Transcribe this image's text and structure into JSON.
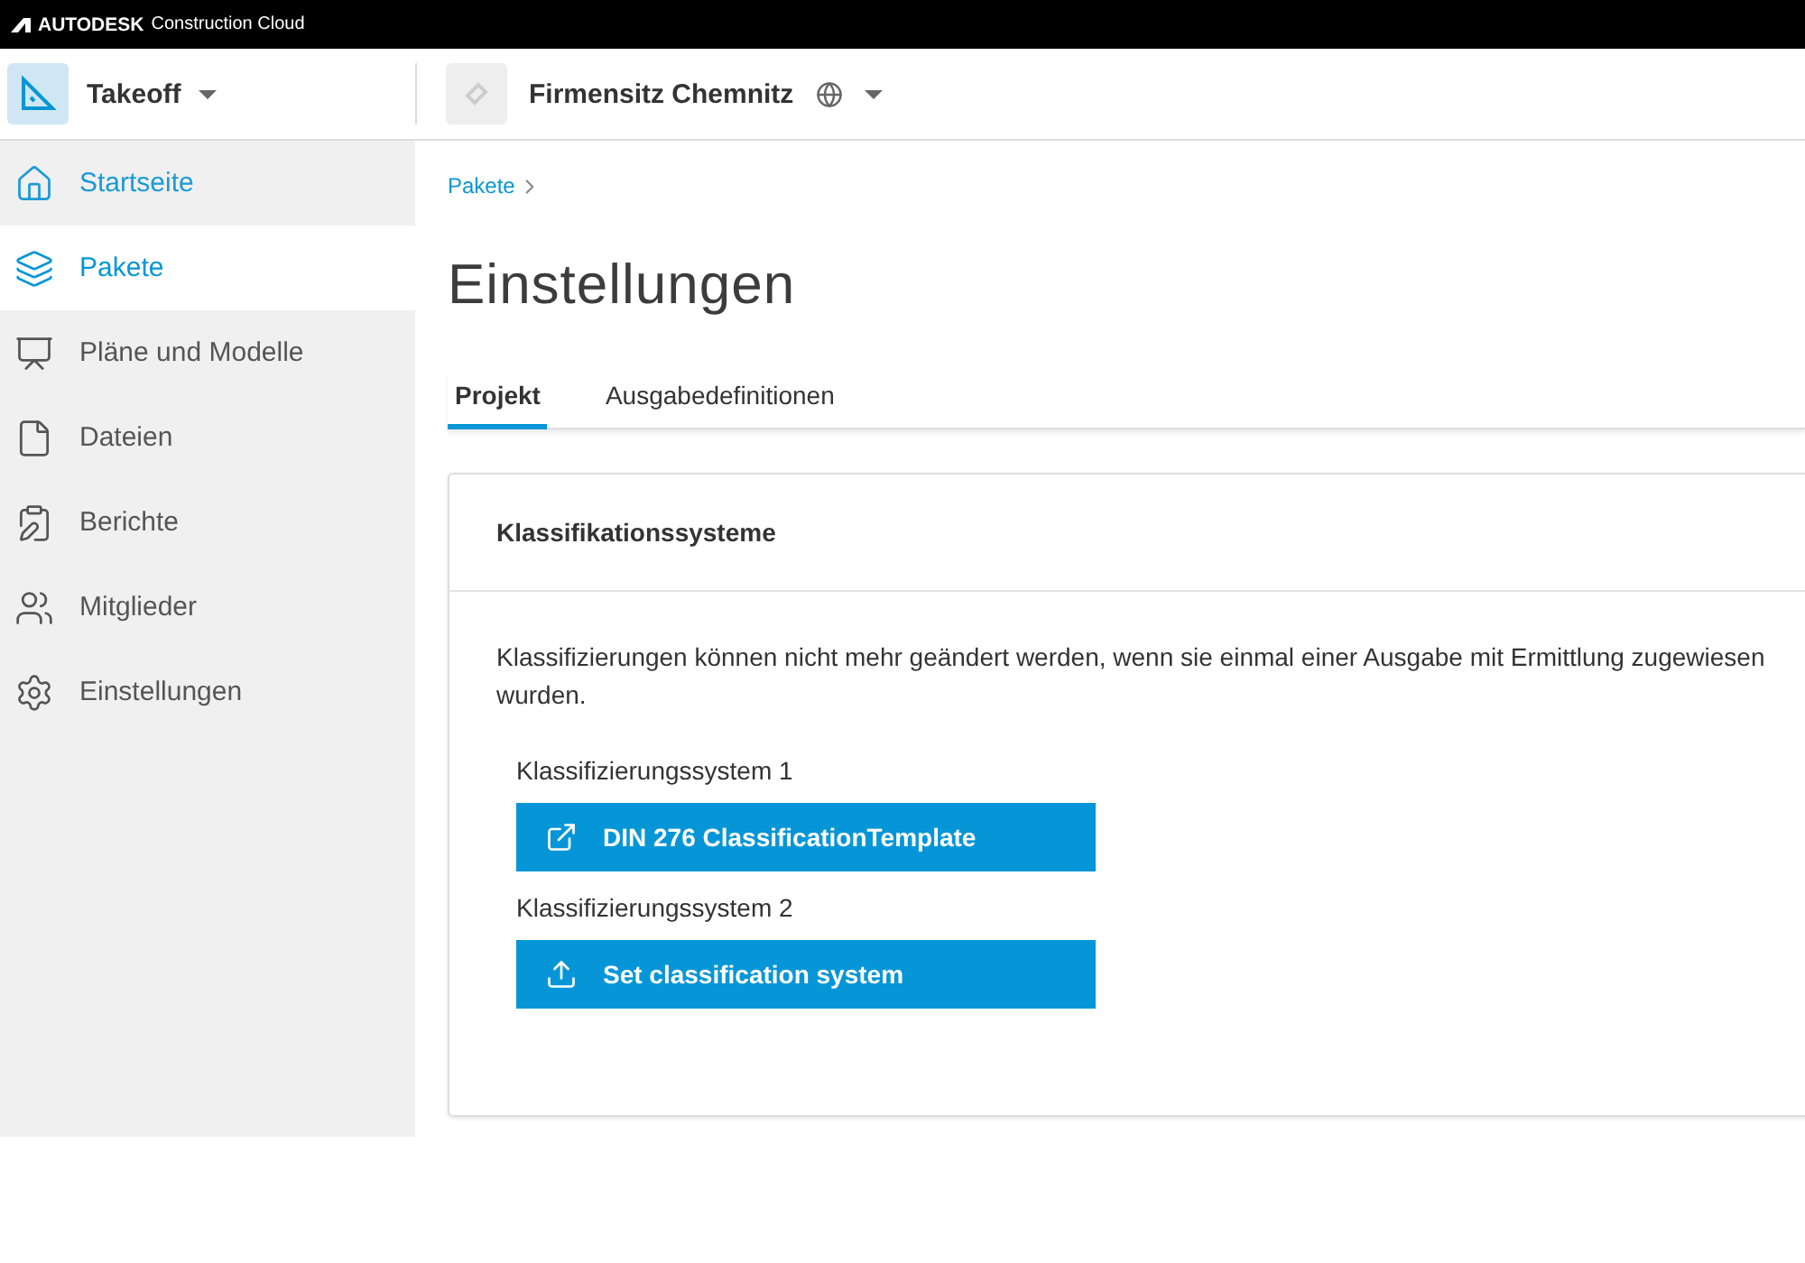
{
  "brand_bar": {
    "logo": "AUTODESK",
    "product": "Construction Cloud"
  },
  "header": {
    "app": "Takeoff",
    "project": "Firmensitz Chemnitz"
  },
  "sidebar": {
    "items": [
      {
        "kind": "home",
        "label": "Startseite",
        "hovered": true,
        "selected": false
      },
      {
        "kind": "packages",
        "label": "Pakete",
        "hovered": false,
        "selected": true
      },
      {
        "kind": "plans",
        "label": "Pläne und Modelle",
        "hovered": false,
        "selected": false
      },
      {
        "kind": "files",
        "label": "Dateien",
        "hovered": false,
        "selected": false
      },
      {
        "kind": "reports",
        "label": "Berichte",
        "hovered": false,
        "selected": false
      },
      {
        "kind": "members",
        "label": "Mitglieder",
        "hovered": false,
        "selected": false
      },
      {
        "kind": "settings",
        "label": "Einstellungen",
        "hovered": false,
        "selected": false
      }
    ]
  },
  "breadcrumb": [
    "Pakete"
  ],
  "page_title": "Einstellungen",
  "tabs": [
    {
      "label": "Projekt",
      "selected": true
    },
    {
      "label": "Ausgabedefinitionen",
      "selected": false
    }
  ],
  "card": {
    "title": "Klassifikationssysteme",
    "note": "Klassifizierungen können nicht mehr geändert werden, wenn sie einmal einer Ausgabe mit Ermittlung zugewiesen wurden.",
    "systems": [
      {
        "label": "Klassifizierungssystem 1",
        "kind": "open",
        "button": "DIN 276 ClassificationTemplate"
      },
      {
        "label": "Klassifizierungssystem 2",
        "kind": "upload",
        "button": "Set classification system"
      }
    ]
  }
}
